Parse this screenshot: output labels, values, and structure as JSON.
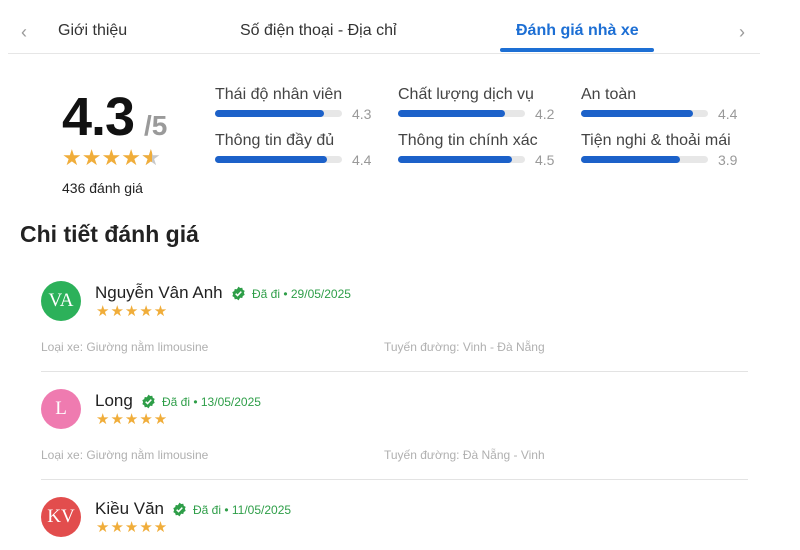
{
  "tabs": {
    "items": [
      {
        "label": "Giới thiệu"
      },
      {
        "label": "Số điện thoại - Địa chỉ"
      },
      {
        "label": "Đánh giá nhà xe"
      }
    ],
    "active_index": 2,
    "prev_icon": "chevron-left-icon",
    "next_icon": "chevron-right-icon"
  },
  "summary": {
    "score": "4.3",
    "score_max": "/5",
    "stars_value": 4.3,
    "review_count": "436 đánh giá"
  },
  "metrics": [
    {
      "label": "Thái độ nhân viên",
      "value": "4.3",
      "fraction": 0.86
    },
    {
      "label": "Chất lượng dịch vụ",
      "value": "4.2",
      "fraction": 0.84
    },
    {
      "label": "An toàn",
      "value": "4.4",
      "fraction": 0.88
    },
    {
      "label": "Thông tin đầy đủ",
      "value": "4.4",
      "fraction": 0.88
    },
    {
      "label": "Thông tin chính xác",
      "value": "4.5",
      "fraction": 0.9
    },
    {
      "label": "Tiện nghi & thoải mái",
      "value": "3.9",
      "fraction": 0.78
    }
  ],
  "section_title": "Chi tiết đánh giá",
  "reviews": [
    {
      "initials": "VA",
      "avatar_color": "#2cb15a",
      "name": "Nguyễn Vân Anh",
      "verified_text": "Đã đi • 29/05/2025",
      "stars": "★★★★★",
      "rating": 5,
      "vehicle": "Loại xe: Giường nằm limousine",
      "route": "Tuyến đường: Vinh - Đà Nẵng"
    },
    {
      "initials": "L",
      "avatar_color": "#ef7bb0",
      "name": "Long",
      "verified_text": "Đã đi • 13/05/2025",
      "stars": "★★★★★",
      "rating": 5,
      "vehicle": "Loại xe: Giường nằm limousine",
      "route": "Tuyến đường: Đà Nẵng - Vinh"
    },
    {
      "initials": "KV",
      "avatar_color": "#e24d4d",
      "name": "Kiều Văn",
      "verified_text": "Đã đi • 11/05/2025",
      "stars": "★★★★★",
      "rating": 5
    }
  ],
  "colors": {
    "accent": "#1d6fd4",
    "bar_fill": "#1c61c9",
    "star": "#f0ad3a",
    "verified": "#2e9e48"
  }
}
